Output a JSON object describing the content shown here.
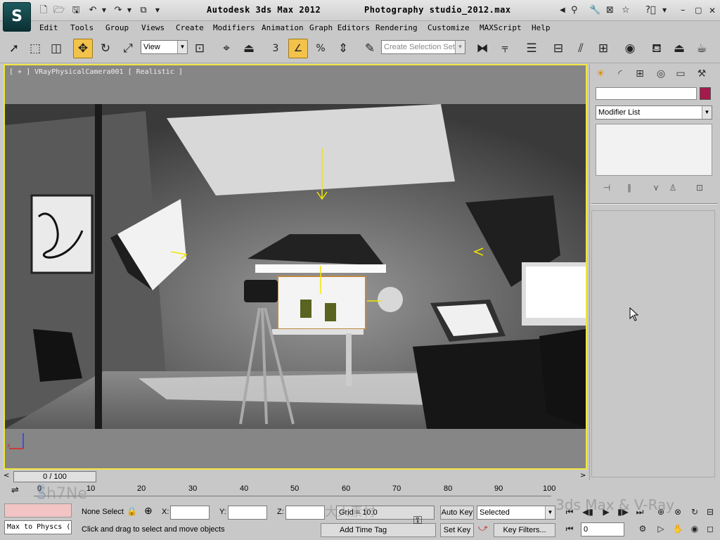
{
  "title_bar": {
    "app_title": "Autodesk 3ds Max  2012",
    "file_title": "Photography studio_2012.max",
    "logo_glyph": "S"
  },
  "menu": [
    "Edit",
    "Tools",
    "Group",
    "Views",
    "Create",
    "Modifiers",
    "Animation",
    "Graph Editors",
    "Rendering",
    "Customize",
    "MAXScript",
    "Help"
  ],
  "toolbar": {
    "reference_coord": "View",
    "selection_set_placeholder": "Create Selection Set",
    "snap_label": "3",
    "angle_snap_label": "∠",
    "percent_snap_label": "%"
  },
  "viewport": {
    "label": "[ + ] VRayPhysicalCamera001 [ Realistic ]"
  },
  "command_panel": {
    "modifier_list": "Modifier List",
    "object_color": "#a51a4c"
  },
  "time_slider": {
    "frame_display": "0 / 100"
  },
  "trackbar": {
    "ticks": [
      "0",
      "10",
      "20",
      "30",
      "40",
      "50",
      "60",
      "70",
      "80",
      "90",
      "100"
    ]
  },
  "status": {
    "script_listener": "Max to Physcs (",
    "selection_info": "None Select",
    "x_label": "X:",
    "y_label": "Y:",
    "z_label": "Z:",
    "grid": "Grid = 10.0",
    "prompt": "Click and drag to select and move objects",
    "add_time_tag": "Add Time Tag",
    "auto_key": "Auto Key",
    "set_key": "Set Key",
    "key_mode": "Selected",
    "key_filters": "Key Filters...",
    "current_frame": "0"
  },
  "watermark": {
    "left_text": "Sh7Ne",
    "right_text": "3ds Max & V-Ray",
    "center_text": "大人素材"
  },
  "colors": {
    "active_tool": "#f2c24a",
    "viewport_border": "#f0e640",
    "object_color": "#a51a4c"
  }
}
